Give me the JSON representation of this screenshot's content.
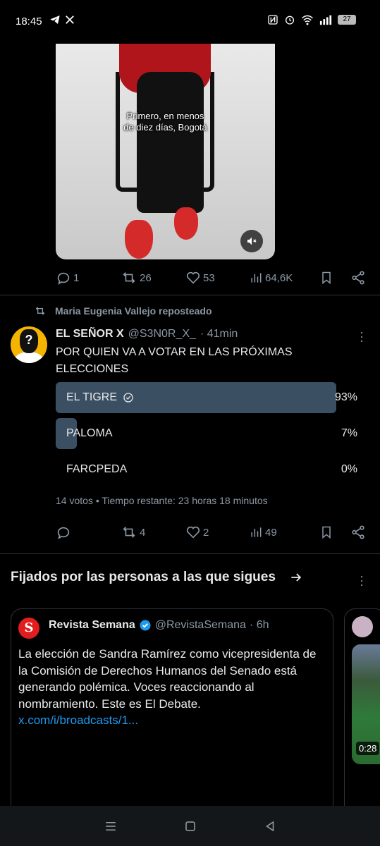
{
  "status_bar": {
    "time": "18:45",
    "battery": "27",
    "left_icons": [
      "telegram-icon",
      "x-logo-icon"
    ],
    "right_icons": [
      "nfc-icon",
      "alarm-icon",
      "wifi-icon",
      "signal-icon",
      "battery-icon"
    ]
  },
  "video_tweet": {
    "caption_line1": "Primero, en menos",
    "caption_line2": "de diez días, Bogotá",
    "stats": {
      "replies": "1",
      "reposts": "26",
      "likes": "53",
      "views": "64,6K"
    }
  },
  "poll_tweet": {
    "repost_label": "Maria Eugenia Vallejo reposteado",
    "author_name": "EL SEÑOR X",
    "author_handle": "@S3N0R_X_",
    "time": "· 41min",
    "text": "POR QUIEN VA A VOTAR EN LAS PRÓXIMAS ELECCIONES",
    "poll": {
      "options": [
        {
          "label": "EL TIGRE",
          "percent": "93%",
          "fraction": 0.93,
          "selected": true
        },
        {
          "label": "PALOMA",
          "percent": "7%",
          "fraction": 0.07,
          "selected": false
        },
        {
          "label": "FARCPEDA",
          "percent": "0%",
          "fraction": 0.0,
          "selected": false
        }
      ],
      "meta": "14 votos • Tiempo restante: 23 horas 18 minutos"
    },
    "stats": {
      "replies": "",
      "reposts": "4",
      "likes": "2",
      "views": "49"
    }
  },
  "pinned_section": {
    "title": "Fijados por las personas a las que sigues",
    "card": {
      "logo_letter": "S",
      "author_name": "Revista Semana",
      "author_handle": "@RevistaSemana",
      "time": "· 6h",
      "text": "La elección de Sandra Ramírez como vicepresidenta de la Comisión de Derechos Humanos del Senado está generando polémica. Voces reaccionando al nombramiento. Este es El Debate. ",
      "link": "x.com/i/broadcasts/1..."
    },
    "card2": {
      "duration": "0:28"
    }
  },
  "colors": {
    "accent": "#1d9bf0",
    "poll_bar": "#3b4f63",
    "muted": "#8b98a5",
    "brand_red": "#e11d1d"
  }
}
